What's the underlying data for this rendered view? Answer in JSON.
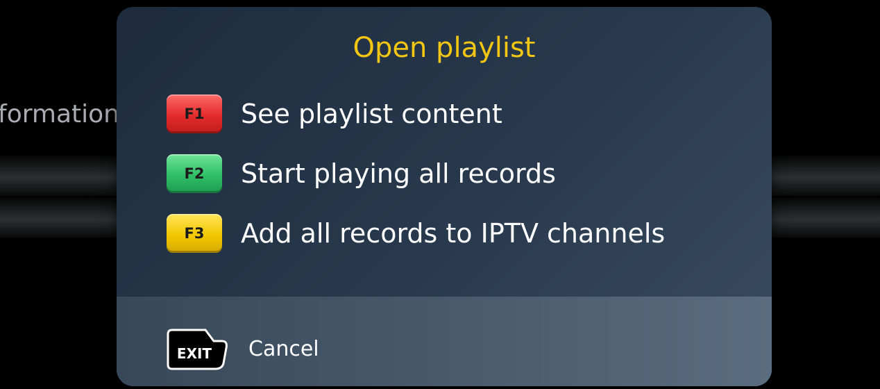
{
  "background": {
    "partial_label": "me Information"
  },
  "dialog": {
    "title": "Open playlist",
    "title_color": "#f3c613",
    "options": [
      {
        "key": "F1",
        "key_color": "#e32b2b",
        "label": "See playlist content"
      },
      {
        "key": "F2",
        "key_color": "#2fbf67",
        "label": "Start playing all records"
      },
      {
        "key": "F3",
        "key_color": "#f2c800",
        "label": "Add all records to IPTV channels"
      }
    ],
    "footer": {
      "exit_key": "EXIT",
      "cancel_label": "Cancel"
    }
  }
}
